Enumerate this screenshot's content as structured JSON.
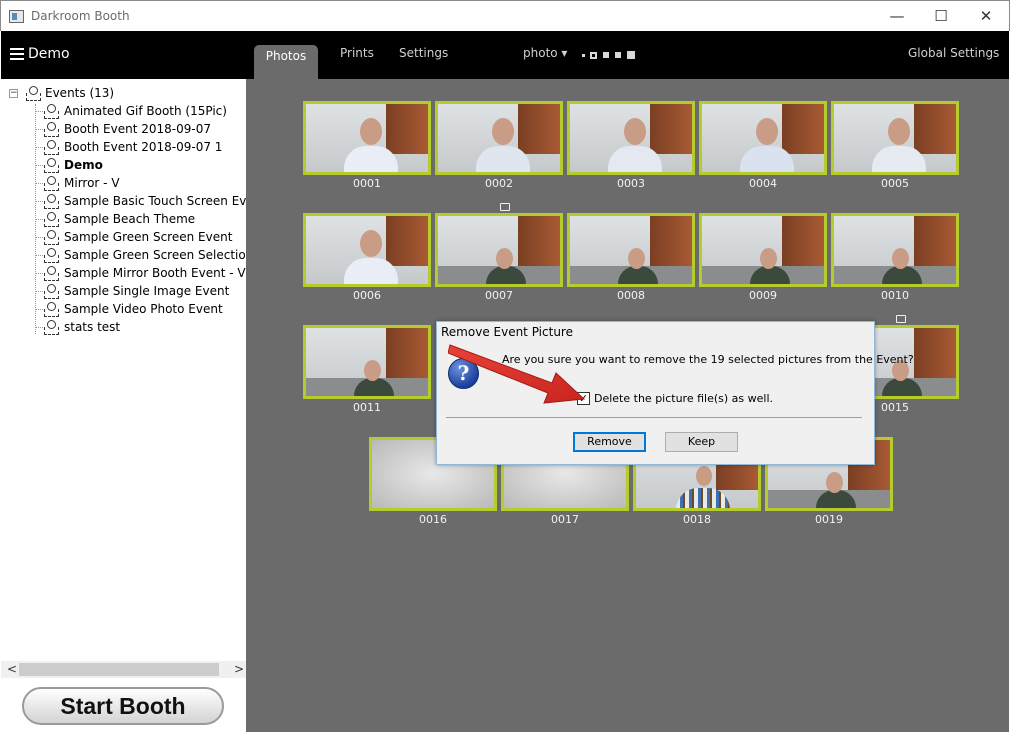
{
  "window": {
    "title": "Darkroom Booth",
    "controls": {
      "minimize": "—",
      "maximize": "☐",
      "close": "✕"
    }
  },
  "topnav": {
    "event_name": "Demo",
    "tabs": [
      {
        "label": "Photos",
        "active": true
      },
      {
        "label": "Prints",
        "active": false
      },
      {
        "label": "Settings",
        "active": false
      }
    ],
    "photo_dropdown": "photo ▾",
    "global_settings": "Global Settings"
  },
  "sidebar": {
    "root_label": "Events (13)",
    "root_expander": "−",
    "events": [
      {
        "label": "Animated Gif Booth (15Pic)",
        "selected": false
      },
      {
        "label": "Booth Event 2018-09-07",
        "selected": false
      },
      {
        "label": "Booth Event 2018-09-07  1",
        "selected": false
      },
      {
        "label": "Demo",
        "selected": true
      },
      {
        "label": "Mirror - V",
        "selected": false
      },
      {
        "label": "Sample Basic Touch Screen Event",
        "selected": false
      },
      {
        "label": "Sample Beach Theme",
        "selected": false
      },
      {
        "label": "Sample Green Screen Event",
        "selected": false
      },
      {
        "label": "Sample Green Screen Selection",
        "selected": false
      },
      {
        "label": "Sample Mirror Booth Event - V",
        "selected": false
      },
      {
        "label": "Sample Single Image Event",
        "selected": false
      },
      {
        "label": "Sample Video Photo Event",
        "selected": false
      },
      {
        "label": "stats test",
        "selected": false
      }
    ],
    "scroll_left": "<",
    "scroll_right": ">",
    "start_booth": "Start Booth"
  },
  "gallery": {
    "photos": [
      {
        "caption": "0001",
        "kind": "shirt"
      },
      {
        "caption": "0002",
        "kind": "shirt"
      },
      {
        "caption": "0003",
        "kind": "shirt"
      },
      {
        "caption": "0004",
        "kind": "shirt"
      },
      {
        "caption": "0005",
        "kind": "shirt"
      },
      {
        "caption": "0006",
        "kind": "shirt"
      },
      {
        "caption": "0007",
        "kind": "dark"
      },
      {
        "caption": "0008",
        "kind": "dark"
      },
      {
        "caption": "0009",
        "kind": "dark"
      },
      {
        "caption": "0010",
        "kind": "dark"
      },
      {
        "caption": "0011",
        "kind": "dark"
      },
      {
        "caption": "0015",
        "kind": "dark"
      },
      {
        "caption": "0016",
        "kind": "blur"
      },
      {
        "caption": "0017",
        "kind": "blur"
      },
      {
        "caption": "0018",
        "kind": "plaid"
      },
      {
        "caption": "0019",
        "kind": "dark"
      }
    ],
    "frame_color": "#b6cc2e",
    "background": "#6b6b6b"
  },
  "dialog": {
    "title": "Remove Event Picture",
    "icon": "question-icon",
    "icon_glyph": "?",
    "message": "Are you sure you want to remove the 19 selected pictures from the Event?",
    "checkbox_label": "Delete the picture file(s) as well.",
    "checkbox_checked": true,
    "checkbox_glyph": "✓",
    "remove_label": "Remove",
    "keep_label": "Keep"
  }
}
